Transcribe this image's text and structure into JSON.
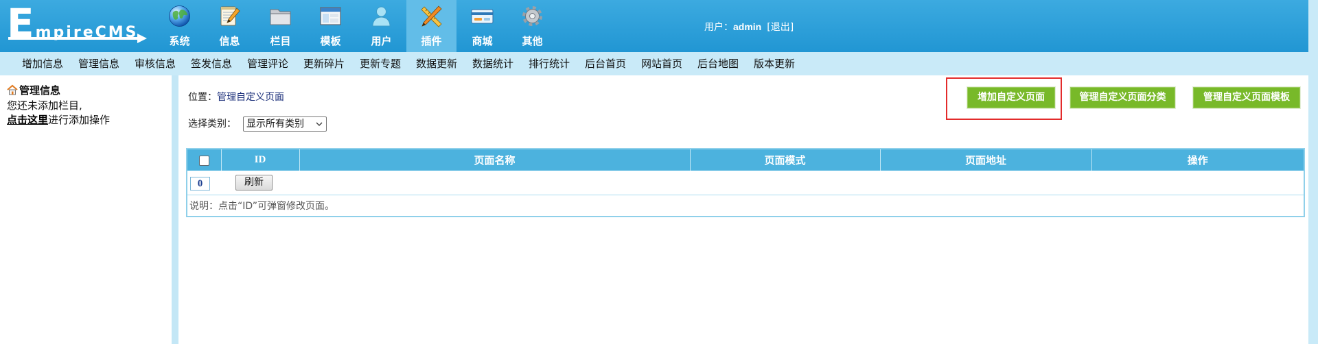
{
  "logo": {
    "text": "EmpireCMS"
  },
  "topnav": {
    "items": [
      {
        "label": "系统",
        "icon": "globe-icon"
      },
      {
        "label": "信息",
        "icon": "notepad-icon"
      },
      {
        "label": "栏目",
        "icon": "folder-icon"
      },
      {
        "label": "模板",
        "icon": "window-icon"
      },
      {
        "label": "用户",
        "icon": "user-icon"
      },
      {
        "label": "插件",
        "icon": "tools-icon",
        "active": true
      },
      {
        "label": "商城",
        "icon": "card-icon"
      },
      {
        "label": "其他",
        "icon": "gear-icon"
      }
    ]
  },
  "user": {
    "prefix": "用户：",
    "name": "admin",
    "logout": "[退出]"
  },
  "submenu": {
    "items": [
      "增加信息",
      "管理信息",
      "审核信息",
      "签发信息",
      "管理评论",
      "更新碎片",
      "更新专题",
      "数据更新",
      "数据统计",
      "排行统计",
      "后台首页",
      "网站首页",
      "后台地图",
      "版本更新"
    ]
  },
  "sidebar": {
    "icon": "home-icon",
    "title": "管理信息",
    "message": "您还未添加栏目,",
    "link": "点击这里",
    "link_suffix": "进行添加操作"
  },
  "breadcrumb": {
    "prefix": "位置：",
    "current": "管理自定义页面"
  },
  "actions": {
    "add_page": "增加自定义页面",
    "manage_classes": "管理自定义页面分类",
    "manage_templates": "管理自定义页面模板"
  },
  "filter": {
    "label": "选择类别：",
    "selected": "显示所有类别"
  },
  "table": {
    "columns": [
      "ID",
      "页面名称",
      "页面模式",
      "页面地址",
      "操作"
    ],
    "page_value": "0",
    "refresh_label": "刷新",
    "note": "说明：点击“ID”可弹窗修改页面。"
  },
  "colors": {
    "header": "#2196d3",
    "active_tab": "#62bde8",
    "subbar": "#c9eaf8",
    "button_green": "#78b929",
    "table_header": "#4cb2de",
    "highlight": "#e32b2b"
  }
}
